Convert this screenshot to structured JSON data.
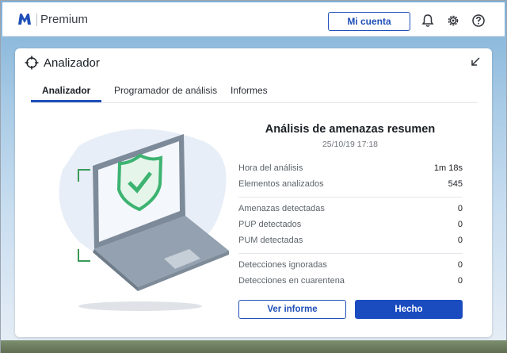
{
  "header": {
    "product_name": "Premium",
    "account_button": "Mi cuenta",
    "icons": [
      "malwarebytes-logo-icon",
      "bell-icon",
      "gear-icon",
      "help-icon"
    ]
  },
  "panel": {
    "title": "Analizador",
    "tabs": [
      {
        "label": "Analizador",
        "active": true
      },
      {
        "label": "Programador de análisis",
        "active": false
      },
      {
        "label": "Informes",
        "active": false
      }
    ]
  },
  "summary": {
    "title": "Análisis de amenazas resumen",
    "date": "25/10/19 17:18",
    "stats": [
      {
        "label": "Hora del análisis",
        "value": "1m 18s"
      },
      {
        "label": "Elementos analizados",
        "value": "545"
      },
      {
        "label": "Amenazas detectadas",
        "value": "0"
      },
      {
        "label": "PUP detectados",
        "value": "0"
      },
      {
        "label": "PUM detectadas",
        "value": "0"
      },
      {
        "label": "Detecciones ignoradas",
        "value": "0"
      },
      {
        "label": "Detecciones en cuarentena",
        "value": "0"
      }
    ]
  },
  "actions": {
    "view_report": "Ver informe",
    "done": "Hecho"
  },
  "colors": {
    "accent": "#1f4fb8",
    "primary_button": "#1a4cc0",
    "shield_green": "#3cb371"
  }
}
